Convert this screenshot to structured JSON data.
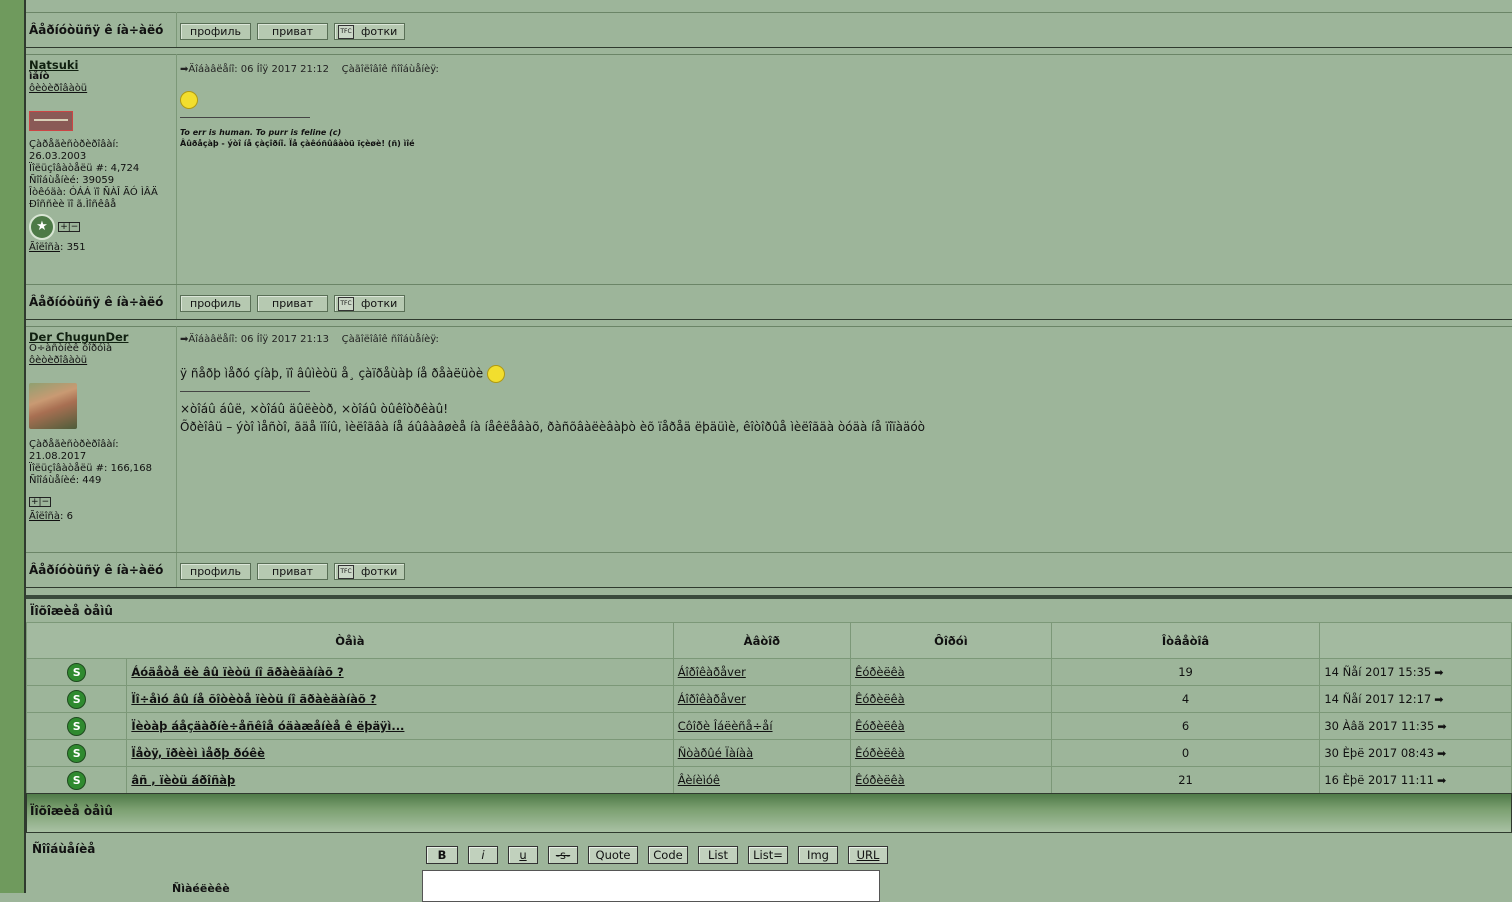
{
  "colors": {
    "page_bg": "#9db59a",
    "left_strip": "#6f9a5d",
    "dark_rule": "#3a4a3c"
  },
  "action_bar": {
    "label": "Âåðíóòüñÿ ê íà÷àëó",
    "buttons": [
      "профиль",
      "приват",
      "фотки"
    ]
  },
  "posts": [
    {
      "nick": "Natsuki",
      "status": "ìåíò",
      "rank": "ôèòèðîâàòü",
      "regdate_label": "Çàðåãèñòðèðîâàí:",
      "regdate": "26.03.2003",
      "user_no": "Ïîëüçîâàòåëü #: 4,724",
      "messages": "Ñîîáùåíèé: 39059",
      "location": "Îòêóäà: ÓÁÁ ïî ÑÀÎ ÃÓ ÌÂÄ Ðîññèè ïî ã.Ìîñêâå",
      "gold_label": "Ãîëîñà",
      "gold_value": ": 351",
      "meta": "Äîáàâëåíî: 06 Íîÿ 2017 21:12",
      "quote_label": "Çàãîëîâîê ñîîáùåíèÿ:",
      "body": "",
      "sig1": "To err is human. To purr is feline (c)",
      "sig2": "Âûðåçàþ - ýòî íå çàçîðíî. Ïå çàêóñûâàòü ïçèøè! (ñ) ìîé"
    },
    {
      "nick": "Der ChugunDer",
      "status": "Ö÷àñòíèê ôîðóìà",
      "rank": "ôèòèðîâàòü",
      "regdate_label": "Çàðåãèñòðèðîâàí:",
      "regdate": "21.08.2017",
      "user_no": "Ïîëüçîâàòåëü #: 166,168",
      "messages": "Ñîîáùåíèé: 449",
      "gold_label": "Ãîëîñà",
      "gold_value": ": 6",
      "meta": "Äîáàâëåíî: 06 Íîÿ 2017 21:13",
      "quote_label": "Çàãîëîâîê ñîîáùåíèÿ:",
      "body": "ÿ ñåðþ ìåðó çíàþ, ïî âûìèòü å¸ çàïðåùàþ íå ðåàëüòè",
      "sig1": "×òîáû áûë, ×òîáû äûëèòð, ×òîáû òûêîòðêàû!",
      "sig2": "Õðèîâü – ýòî ìåñòî, ãäå ïîíû, ìèëîãâà íå áûâàâøèå íà íåêëåâàõ, ðàñõâàëèâàþò èõ ïåðåä ëþäüìè, êîòîðûå ìèëîãäà òóäà íå ïîïàäóò"
    }
  ],
  "similar": {
    "title": "Ïîõîæèå òåìû",
    "headers": [
      "Òåìà",
      "Àâòîð",
      "Ôîðóì",
      "Îòâåòîâ",
      ""
    ],
    "rows": [
      {
        "topic": "Áóäåòå ëè âû ïèòü íî ãðàèäàíàõ ?",
        "author": "Áîðîêàðåver",
        "forum": "Êóðèëêà",
        "replies": "19",
        "last": "14 Ñåí 2017 15:35"
      },
      {
        "topic": "Ïî÷åìó âû íå õîòèòå ïèòü íî ãðàèäàíàõ ?",
        "author": "Áîðîêàðåver",
        "forum": "Êóðèëêà",
        "replies": "4",
        "last": "14 Ñåí 2017 12:17"
      },
      {
        "topic": "Ïèòàþ áåçäàðíè÷åñêîå óäàæåíèå ê ëþäÿì...",
        "author": "Côîðè Îáëèñå÷åí",
        "forum": "Êóðèëêà",
        "replies": "6",
        "last": "30 Àâã 2017 11:35"
      },
      {
        "topic": "Ïåòÿ, ïðèèì ìåðþ ðóêè",
        "author": "Ñòàðûé Ïàíàà",
        "forum": "Êóðèëêà",
        "replies": "0",
        "last": "30 Èþë 2017 08:43"
      },
      {
        "topic": "âñ , ïèòü áðîñàþ",
        "author": "Âèíèìóê",
        "forum": "Êóðèëêà",
        "replies": "21",
        "last": "16 Èþë 2017 11:11"
      }
    ],
    "footer": "Ïîõîæèå òåìû"
  },
  "reply": {
    "label": "Ñîîáùåíèå",
    "sub": "Ñìàéëèêè",
    "buttons": [
      "B",
      "i",
      "u",
      "-s-",
      "Quote",
      "Code",
      "List",
      "List=",
      "Img",
      "URL"
    ]
  }
}
